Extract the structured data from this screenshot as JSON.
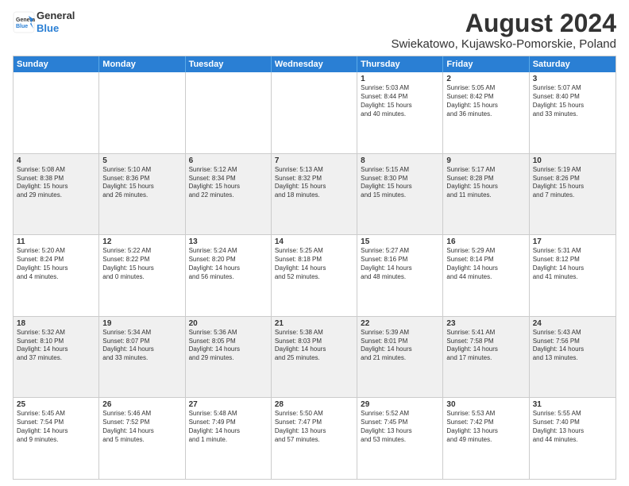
{
  "header": {
    "logo_line1": "General",
    "logo_line2": "Blue",
    "title": "August 2024",
    "subtitle": "Swiekatowo, Kujawsko-Pomorskie, Poland"
  },
  "weekdays": [
    "Sunday",
    "Monday",
    "Tuesday",
    "Wednesday",
    "Thursday",
    "Friday",
    "Saturday"
  ],
  "rows": [
    [
      {
        "day": "",
        "info": ""
      },
      {
        "day": "",
        "info": ""
      },
      {
        "day": "",
        "info": ""
      },
      {
        "day": "",
        "info": ""
      },
      {
        "day": "1",
        "info": "Sunrise: 5:03 AM\nSunset: 8:44 PM\nDaylight: 15 hours\nand 40 minutes."
      },
      {
        "day": "2",
        "info": "Sunrise: 5:05 AM\nSunset: 8:42 PM\nDaylight: 15 hours\nand 36 minutes."
      },
      {
        "day": "3",
        "info": "Sunrise: 5:07 AM\nSunset: 8:40 PM\nDaylight: 15 hours\nand 33 minutes."
      }
    ],
    [
      {
        "day": "4",
        "info": "Sunrise: 5:08 AM\nSunset: 8:38 PM\nDaylight: 15 hours\nand 29 minutes."
      },
      {
        "day": "5",
        "info": "Sunrise: 5:10 AM\nSunset: 8:36 PM\nDaylight: 15 hours\nand 26 minutes."
      },
      {
        "day": "6",
        "info": "Sunrise: 5:12 AM\nSunset: 8:34 PM\nDaylight: 15 hours\nand 22 minutes."
      },
      {
        "day": "7",
        "info": "Sunrise: 5:13 AM\nSunset: 8:32 PM\nDaylight: 15 hours\nand 18 minutes."
      },
      {
        "day": "8",
        "info": "Sunrise: 5:15 AM\nSunset: 8:30 PM\nDaylight: 15 hours\nand 15 minutes."
      },
      {
        "day": "9",
        "info": "Sunrise: 5:17 AM\nSunset: 8:28 PM\nDaylight: 15 hours\nand 11 minutes."
      },
      {
        "day": "10",
        "info": "Sunrise: 5:19 AM\nSunset: 8:26 PM\nDaylight: 15 hours\nand 7 minutes."
      }
    ],
    [
      {
        "day": "11",
        "info": "Sunrise: 5:20 AM\nSunset: 8:24 PM\nDaylight: 15 hours\nand 4 minutes."
      },
      {
        "day": "12",
        "info": "Sunrise: 5:22 AM\nSunset: 8:22 PM\nDaylight: 15 hours\nand 0 minutes."
      },
      {
        "day": "13",
        "info": "Sunrise: 5:24 AM\nSunset: 8:20 PM\nDaylight: 14 hours\nand 56 minutes."
      },
      {
        "day": "14",
        "info": "Sunrise: 5:25 AM\nSunset: 8:18 PM\nDaylight: 14 hours\nand 52 minutes."
      },
      {
        "day": "15",
        "info": "Sunrise: 5:27 AM\nSunset: 8:16 PM\nDaylight: 14 hours\nand 48 minutes."
      },
      {
        "day": "16",
        "info": "Sunrise: 5:29 AM\nSunset: 8:14 PM\nDaylight: 14 hours\nand 44 minutes."
      },
      {
        "day": "17",
        "info": "Sunrise: 5:31 AM\nSunset: 8:12 PM\nDaylight: 14 hours\nand 41 minutes."
      }
    ],
    [
      {
        "day": "18",
        "info": "Sunrise: 5:32 AM\nSunset: 8:10 PM\nDaylight: 14 hours\nand 37 minutes."
      },
      {
        "day": "19",
        "info": "Sunrise: 5:34 AM\nSunset: 8:07 PM\nDaylight: 14 hours\nand 33 minutes."
      },
      {
        "day": "20",
        "info": "Sunrise: 5:36 AM\nSunset: 8:05 PM\nDaylight: 14 hours\nand 29 minutes."
      },
      {
        "day": "21",
        "info": "Sunrise: 5:38 AM\nSunset: 8:03 PM\nDaylight: 14 hours\nand 25 minutes."
      },
      {
        "day": "22",
        "info": "Sunrise: 5:39 AM\nSunset: 8:01 PM\nDaylight: 14 hours\nand 21 minutes."
      },
      {
        "day": "23",
        "info": "Sunrise: 5:41 AM\nSunset: 7:58 PM\nDaylight: 14 hours\nand 17 minutes."
      },
      {
        "day": "24",
        "info": "Sunrise: 5:43 AM\nSunset: 7:56 PM\nDaylight: 14 hours\nand 13 minutes."
      }
    ],
    [
      {
        "day": "25",
        "info": "Sunrise: 5:45 AM\nSunset: 7:54 PM\nDaylight: 14 hours\nand 9 minutes."
      },
      {
        "day": "26",
        "info": "Sunrise: 5:46 AM\nSunset: 7:52 PM\nDaylight: 14 hours\nand 5 minutes."
      },
      {
        "day": "27",
        "info": "Sunrise: 5:48 AM\nSunset: 7:49 PM\nDaylight: 14 hours\nand 1 minute."
      },
      {
        "day": "28",
        "info": "Sunrise: 5:50 AM\nSunset: 7:47 PM\nDaylight: 13 hours\nand 57 minutes."
      },
      {
        "day": "29",
        "info": "Sunrise: 5:52 AM\nSunset: 7:45 PM\nDaylight: 13 hours\nand 53 minutes."
      },
      {
        "day": "30",
        "info": "Sunrise: 5:53 AM\nSunset: 7:42 PM\nDaylight: 13 hours\nand 49 minutes."
      },
      {
        "day": "31",
        "info": "Sunrise: 5:55 AM\nSunset: 7:40 PM\nDaylight: 13 hours\nand 44 minutes."
      }
    ]
  ]
}
